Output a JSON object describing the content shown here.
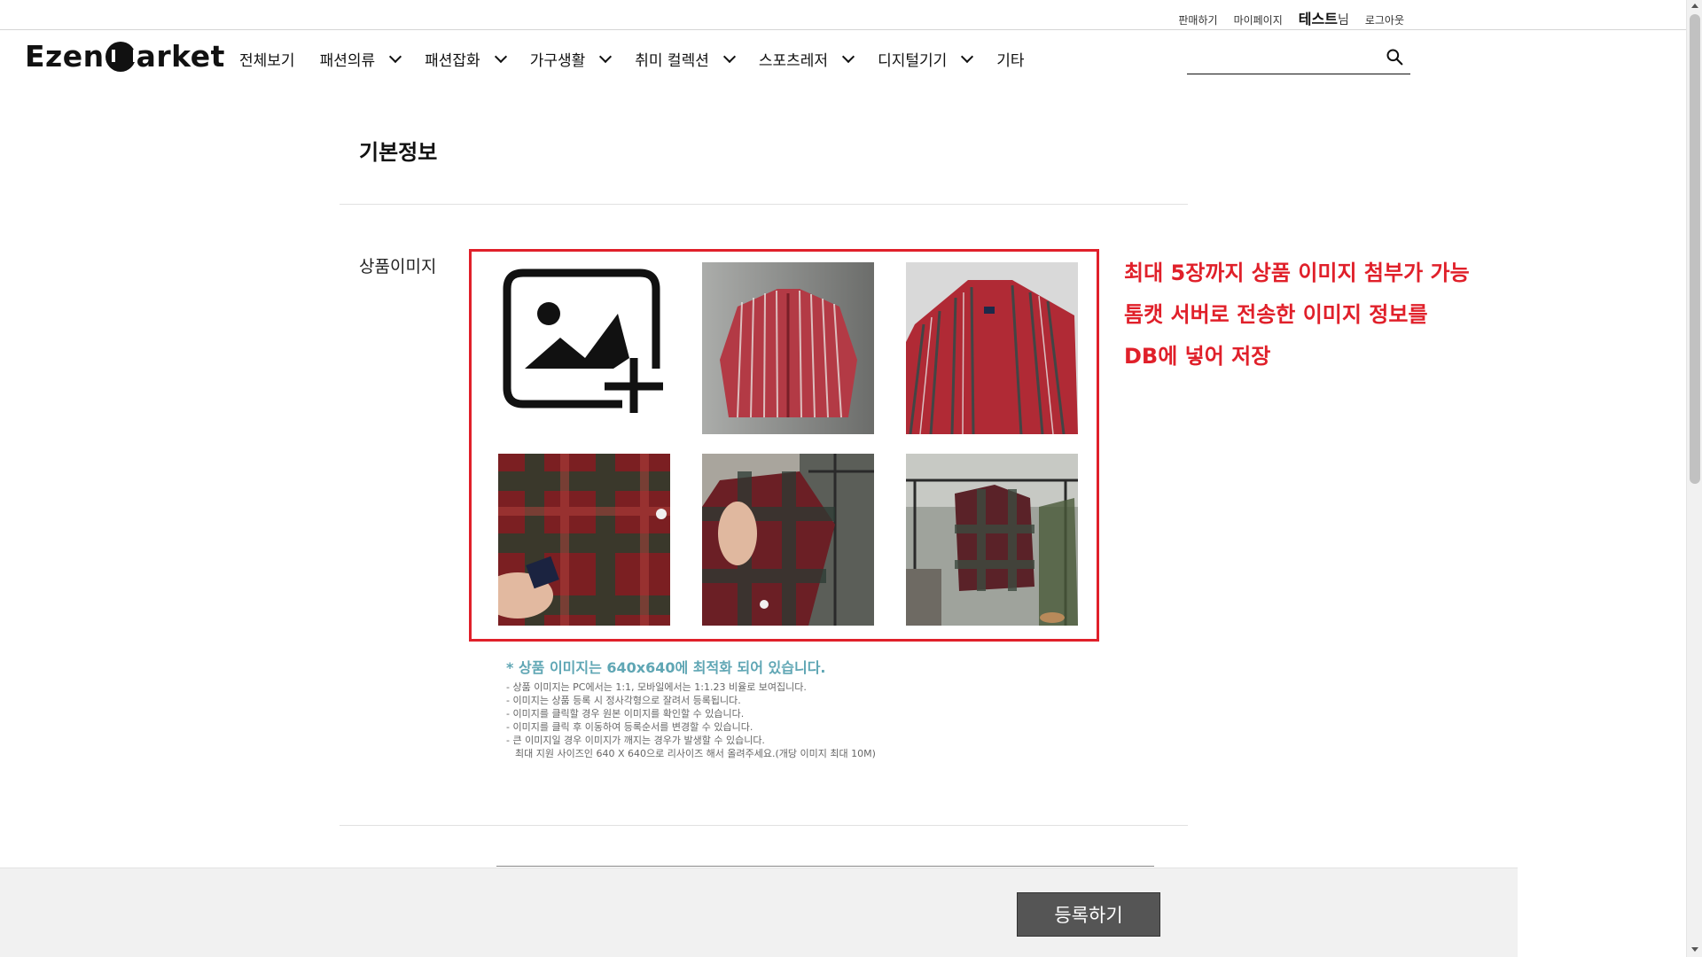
{
  "utility": {
    "sell_label": "판매하기",
    "mypage_label": "마이페이지",
    "user_name": "테스트",
    "user_suffix": "님",
    "logout_label": "로그아웃"
  },
  "header": {
    "logo_left": "Ezen",
    "logo_right": "arket",
    "nav": [
      {
        "label": "전체보기",
        "dropdown": false
      },
      {
        "label": "패션의류",
        "dropdown": true
      },
      {
        "label": "패션잡화",
        "dropdown": true
      },
      {
        "label": "가구생활",
        "dropdown": true
      },
      {
        "label": "취미 컬렉션",
        "dropdown": true
      },
      {
        "label": "스포츠레저",
        "dropdown": true
      },
      {
        "label": "디지털기기",
        "dropdown": true
      },
      {
        "label": "기타",
        "dropdown": false
      }
    ],
    "search_placeholder": ""
  },
  "main": {
    "section_title": "기본정보",
    "image_label": "상품이미지",
    "images": [
      {
        "kind": "add",
        "icon": "add-image-icon"
      },
      {
        "kind": "photo",
        "desc": "red-striped-shirt-flat",
        "colors": [
          "#b33a45",
          "#e8e0dd",
          "#7a8c86"
        ]
      },
      {
        "kind": "photo",
        "desc": "red-striped-shirt-closeup",
        "colors": [
          "#b02a35",
          "#2f4a48",
          "#e6e6e6"
        ]
      },
      {
        "kind": "photo",
        "desc": "plaid-shirt-label",
        "colors": [
          "#7b1f22",
          "#2a3f2e",
          "#b5443e"
        ]
      },
      {
        "kind": "photo",
        "desc": "plaid-shirt-hanger",
        "colors": [
          "#6b1f25",
          "#2b3a33",
          "#a9a59d"
        ]
      },
      {
        "kind": "photo",
        "desc": "plaid-shirt-rack",
        "colors": [
          "#5a2228",
          "#3d4a3f",
          "#9fa39c"
        ]
      }
    ],
    "annotation_lines": [
      "최대 5장까지 상품 이미지 첨부가 가능",
      "톰캣 서버로 전송한 이미지 정보를",
      "DB에 넣어 저장"
    ],
    "notes_title": "* 상품 이미지는 640x640에 최적화 되어 있습니다.",
    "notes": [
      "- 상품 이미지는 PC에서는 1:1, 모바일에서는 1:1.23 비율로 보여집니다.",
      "- 이미지는 상품 등록 시 정사각형으로 잘려서 등록됩니다.",
      "- 이미지를 클릭할 경우 원본 이미지를 확인할 수 있습니다.",
      "- 이미지를 클릭 후 이동하여 등록순서를 변경할 수 있습니다.",
      "- 큰 이미지일 경우 이미지가 깨지는 경우가 발생할 수 있습니다.",
      "  최대 지원 사이즈인 640 X 640으로 리사이즈 해서 올려주세요.(개당 이미지 최대 10M)"
    ],
    "submit_label": "등록하기"
  },
  "colors": {
    "accent_red": "#e0202a",
    "notes_teal": "#5fa6b4",
    "button_gray": "#555555"
  }
}
